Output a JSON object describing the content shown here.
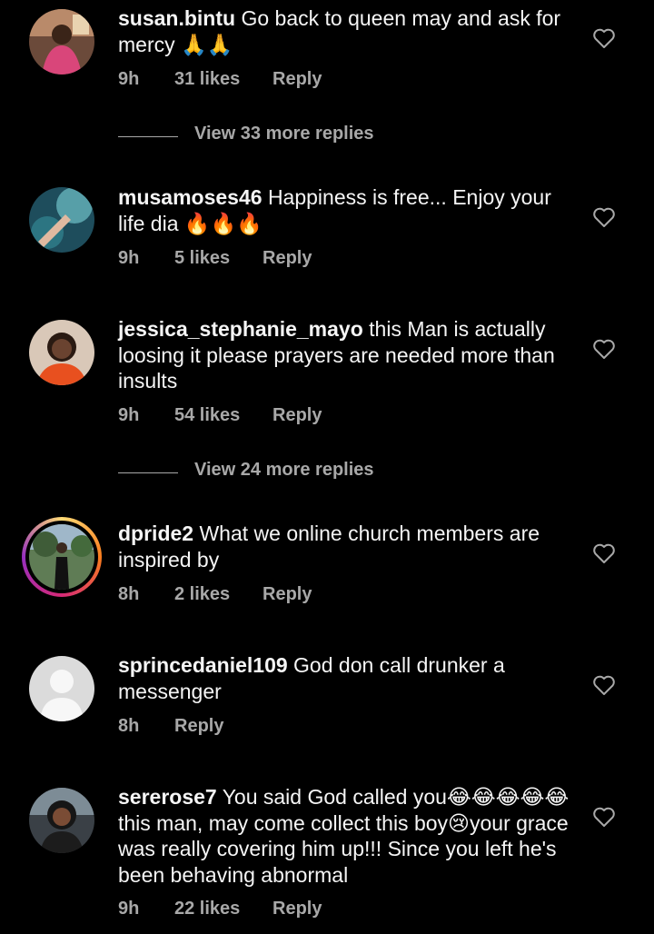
{
  "comments": [
    {
      "username": "susan.bintu",
      "text": "Go back to queen may and ask for mercy 🙏🙏",
      "time": "9h",
      "likes": "31 likes",
      "reply": "Reply",
      "view_more": "View 33 more replies"
    },
    {
      "username": "musamoses46",
      "text": "Happiness is free... Enjoy your life dia 🔥🔥🔥",
      "time": "9h",
      "likes": "5 likes",
      "reply": "Reply"
    },
    {
      "username": "jessica_stephanie_mayo",
      "text": "this Man is actually loosing it please prayers are needed more than insults",
      "time": "9h",
      "likes": "54 likes",
      "reply": "Reply",
      "view_more": "View 24 more replies"
    },
    {
      "username": "dpride2",
      "text": "What we online church members are inspired by",
      "time": "8h",
      "likes": "2 likes",
      "reply": "Reply"
    },
    {
      "username": "sprincedaniel109",
      "text": "God don call drunker a messenger",
      "time": "8h",
      "reply": "Reply"
    },
    {
      "username": "sererose7",
      "text": "You said God called you😂😂😂😂😂this man, may come collect this boy😢your grace was really covering him up!!! Since you left he's been behaving abnormal",
      "time": "9h",
      "likes": "22 likes",
      "reply": "Reply"
    }
  ],
  "colors": {
    "background": "#000000",
    "text": "#f5f5f5",
    "muted": "#a8a8a8",
    "story_ring": [
      "#feda75",
      "#fa7e1e",
      "#d62976",
      "#962fbf"
    ]
  },
  "icons": {
    "like": "heart-outline-icon",
    "default_avatar": "person-silhouette-icon"
  }
}
